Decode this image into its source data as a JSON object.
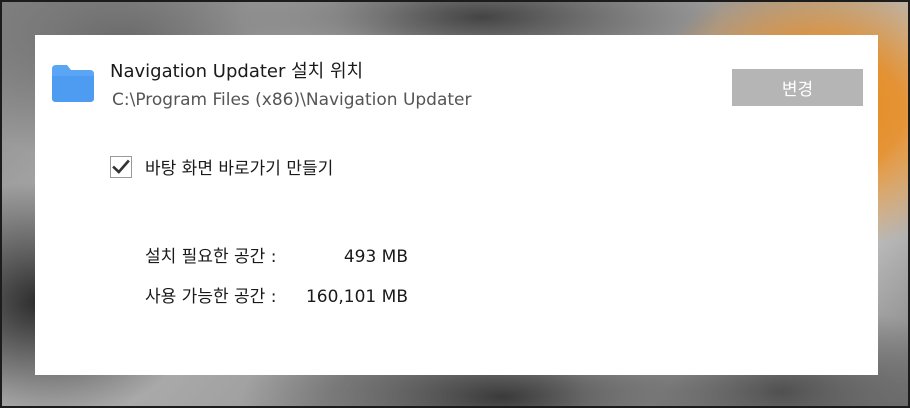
{
  "install": {
    "title": "Navigation Updater 설치 위치",
    "path": "C:\\Program Files (x86)\\Navigation Updater",
    "change_label": "변경",
    "folder_icon": "folder-icon",
    "folder_color": "#5aa6f5"
  },
  "shortcut": {
    "checked": true,
    "label": "바탕 화면 바로가기 만들기",
    "check_icon": "checkmark-icon"
  },
  "space": {
    "required_label": "설치 필요한 공간 :",
    "required_value": "493 MB",
    "available_label": "사용 가능한 공간 :",
    "available_value": "160,101 MB"
  },
  "colors": {
    "button_bg": "#b5b5b5",
    "panel_bg": "#ffffff",
    "accent_orange": "#e98a1c"
  }
}
